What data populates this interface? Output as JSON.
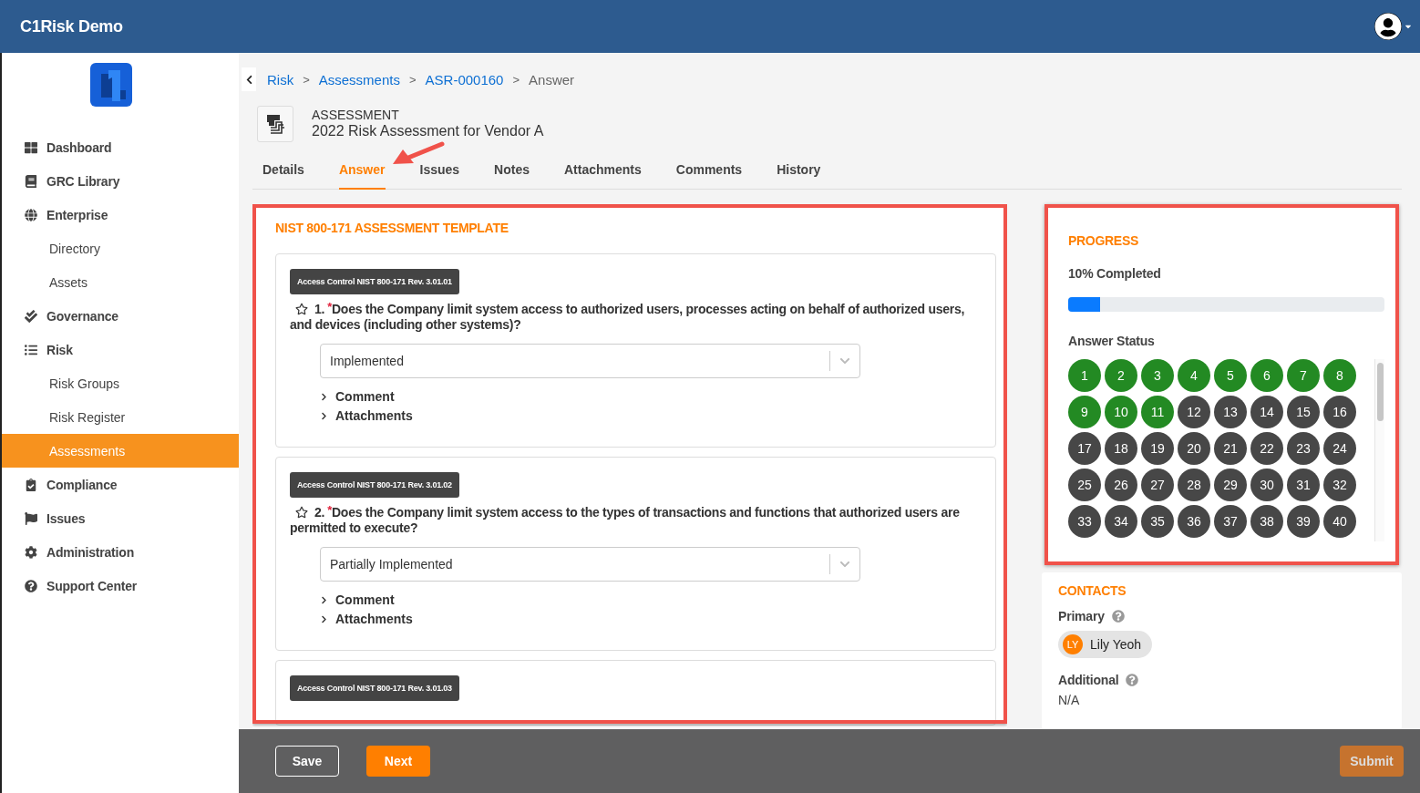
{
  "app_title": "C1Risk Demo",
  "sidebar": {
    "items": [
      {
        "label": "Dashboard",
        "selected": false
      },
      {
        "label": "GRC Library",
        "selected": false
      },
      {
        "label": "Enterprise",
        "selected": false,
        "children": [
          {
            "label": "Directory",
            "selected": false
          },
          {
            "label": "Assets",
            "selected": false
          }
        ]
      },
      {
        "label": "Governance",
        "selected": false
      },
      {
        "label": "Risk",
        "selected": false,
        "children": [
          {
            "label": "Risk Groups",
            "selected": false
          },
          {
            "label": "Risk Register",
            "selected": false
          },
          {
            "label": "Assessments",
            "selected": true
          }
        ]
      },
      {
        "label": "Compliance",
        "selected": false
      },
      {
        "label": "Issues",
        "selected": false
      },
      {
        "label": "Administration",
        "selected": false
      },
      {
        "label": "Support Center",
        "selected": false
      }
    ]
  },
  "breadcrumb": [
    {
      "label": "Risk",
      "kind": "link",
      "separator": ">"
    },
    {
      "label": "Assessments",
      "kind": "link",
      "separator": ">"
    },
    {
      "label": "ASR-000160",
      "kind": "link",
      "separator": ">"
    },
    {
      "label": "Answer",
      "kind": "current"
    }
  ],
  "record": {
    "type_label": "ASSESSMENT",
    "title": "2022 Risk Assessment for Vendor A"
  },
  "tabs": [
    {
      "label": "Details",
      "selected": false
    },
    {
      "label": "Answer",
      "selected": true
    },
    {
      "label": "Issues",
      "selected": false
    },
    {
      "label": "Notes",
      "selected": false
    },
    {
      "label": "Attachments",
      "selected": false
    },
    {
      "label": "Comments",
      "selected": false
    },
    {
      "label": "History",
      "selected": false
    }
  ],
  "template": {
    "title": "NIST 800-171 ASSESSMENT TEMPLATE",
    "questions": [
      {
        "tag": "Access Control NIST 800-171 Rev. 3.01.01",
        "starred": false,
        "number": "1.",
        "required_mark": "*",
        "text": "Does the Company limit system access to authorized users, processes acting on behalf of authorized users, and devices (including other systems)?",
        "answer": "Implemented",
        "sections": [
          {
            "label": "Comment",
            "expanded": false
          },
          {
            "label": "Attachments",
            "expanded": false
          }
        ]
      },
      {
        "tag": "Access Control NIST 800-171 Rev. 3.01.02",
        "starred": false,
        "number": "2.",
        "required_mark": "*",
        "text": "Does the Company limit system access to the types of transactions and functions that authorized users are permitted to execute?",
        "answer": "Partially Implemented",
        "sections": [
          {
            "label": "Comment",
            "expanded": false
          },
          {
            "label": "Attachments",
            "expanded": false
          }
        ]
      },
      {
        "tag": "Access Control NIST 800-171 Rev. 3.01.03"
      }
    ]
  },
  "progress": {
    "title": "PROGRESS",
    "completed_label": "10% Completed",
    "level": 0.1,
    "status_title": "Answer Status",
    "answers": [
      {
        "label": "1",
        "answered": true
      },
      {
        "label": "2",
        "answered": true
      },
      {
        "label": "3",
        "answered": true
      },
      {
        "label": "4",
        "answered": true
      },
      {
        "label": "5",
        "answered": true
      },
      {
        "label": "6",
        "answered": true
      },
      {
        "label": "7",
        "answered": true
      },
      {
        "label": "8",
        "answered": true
      },
      {
        "label": "9",
        "answered": true
      },
      {
        "label": "10",
        "answered": true
      },
      {
        "label": "11",
        "answered": true
      },
      {
        "label": "12",
        "answered": false
      },
      {
        "label": "13",
        "answered": false
      },
      {
        "label": "14",
        "answered": false
      },
      {
        "label": "15",
        "answered": false
      },
      {
        "label": "16",
        "answered": false
      },
      {
        "label": "17",
        "answered": false
      },
      {
        "label": "18",
        "answered": false
      },
      {
        "label": "19",
        "answered": false
      },
      {
        "label": "20",
        "answered": false
      },
      {
        "label": "21",
        "answered": false
      },
      {
        "label": "22",
        "answered": false
      },
      {
        "label": "23",
        "answered": false
      },
      {
        "label": "24",
        "answered": false
      },
      {
        "label": "25",
        "answered": false
      },
      {
        "label": "26",
        "answered": false
      },
      {
        "label": "27",
        "answered": false
      },
      {
        "label": "28",
        "answered": false
      },
      {
        "label": "29",
        "answered": false
      },
      {
        "label": "30",
        "answered": false
      },
      {
        "label": "31",
        "answered": false
      },
      {
        "label": "32",
        "answered": false
      },
      {
        "label": "33",
        "answered": false
      },
      {
        "label": "34",
        "answered": false
      },
      {
        "label": "35",
        "answered": false
      },
      {
        "label": "36",
        "answered": false
      },
      {
        "label": "37",
        "answered": false
      },
      {
        "label": "38",
        "answered": false
      },
      {
        "label": "39",
        "answered": false
      },
      {
        "label": "40",
        "answered": false
      }
    ]
  },
  "contacts": {
    "title": "CONTACTS",
    "primary_label": "Primary",
    "primary": {
      "initials": "LY",
      "name": "Lily Yeoh"
    },
    "additional_label": "Additional",
    "additional_value": "N/A"
  },
  "footer": {
    "buttons": [
      {
        "label": "Save",
        "kind": "outline"
      },
      {
        "label": "Next",
        "kind": "primary"
      }
    ],
    "submit": {
      "label": "Submit",
      "disabled": true
    }
  }
}
